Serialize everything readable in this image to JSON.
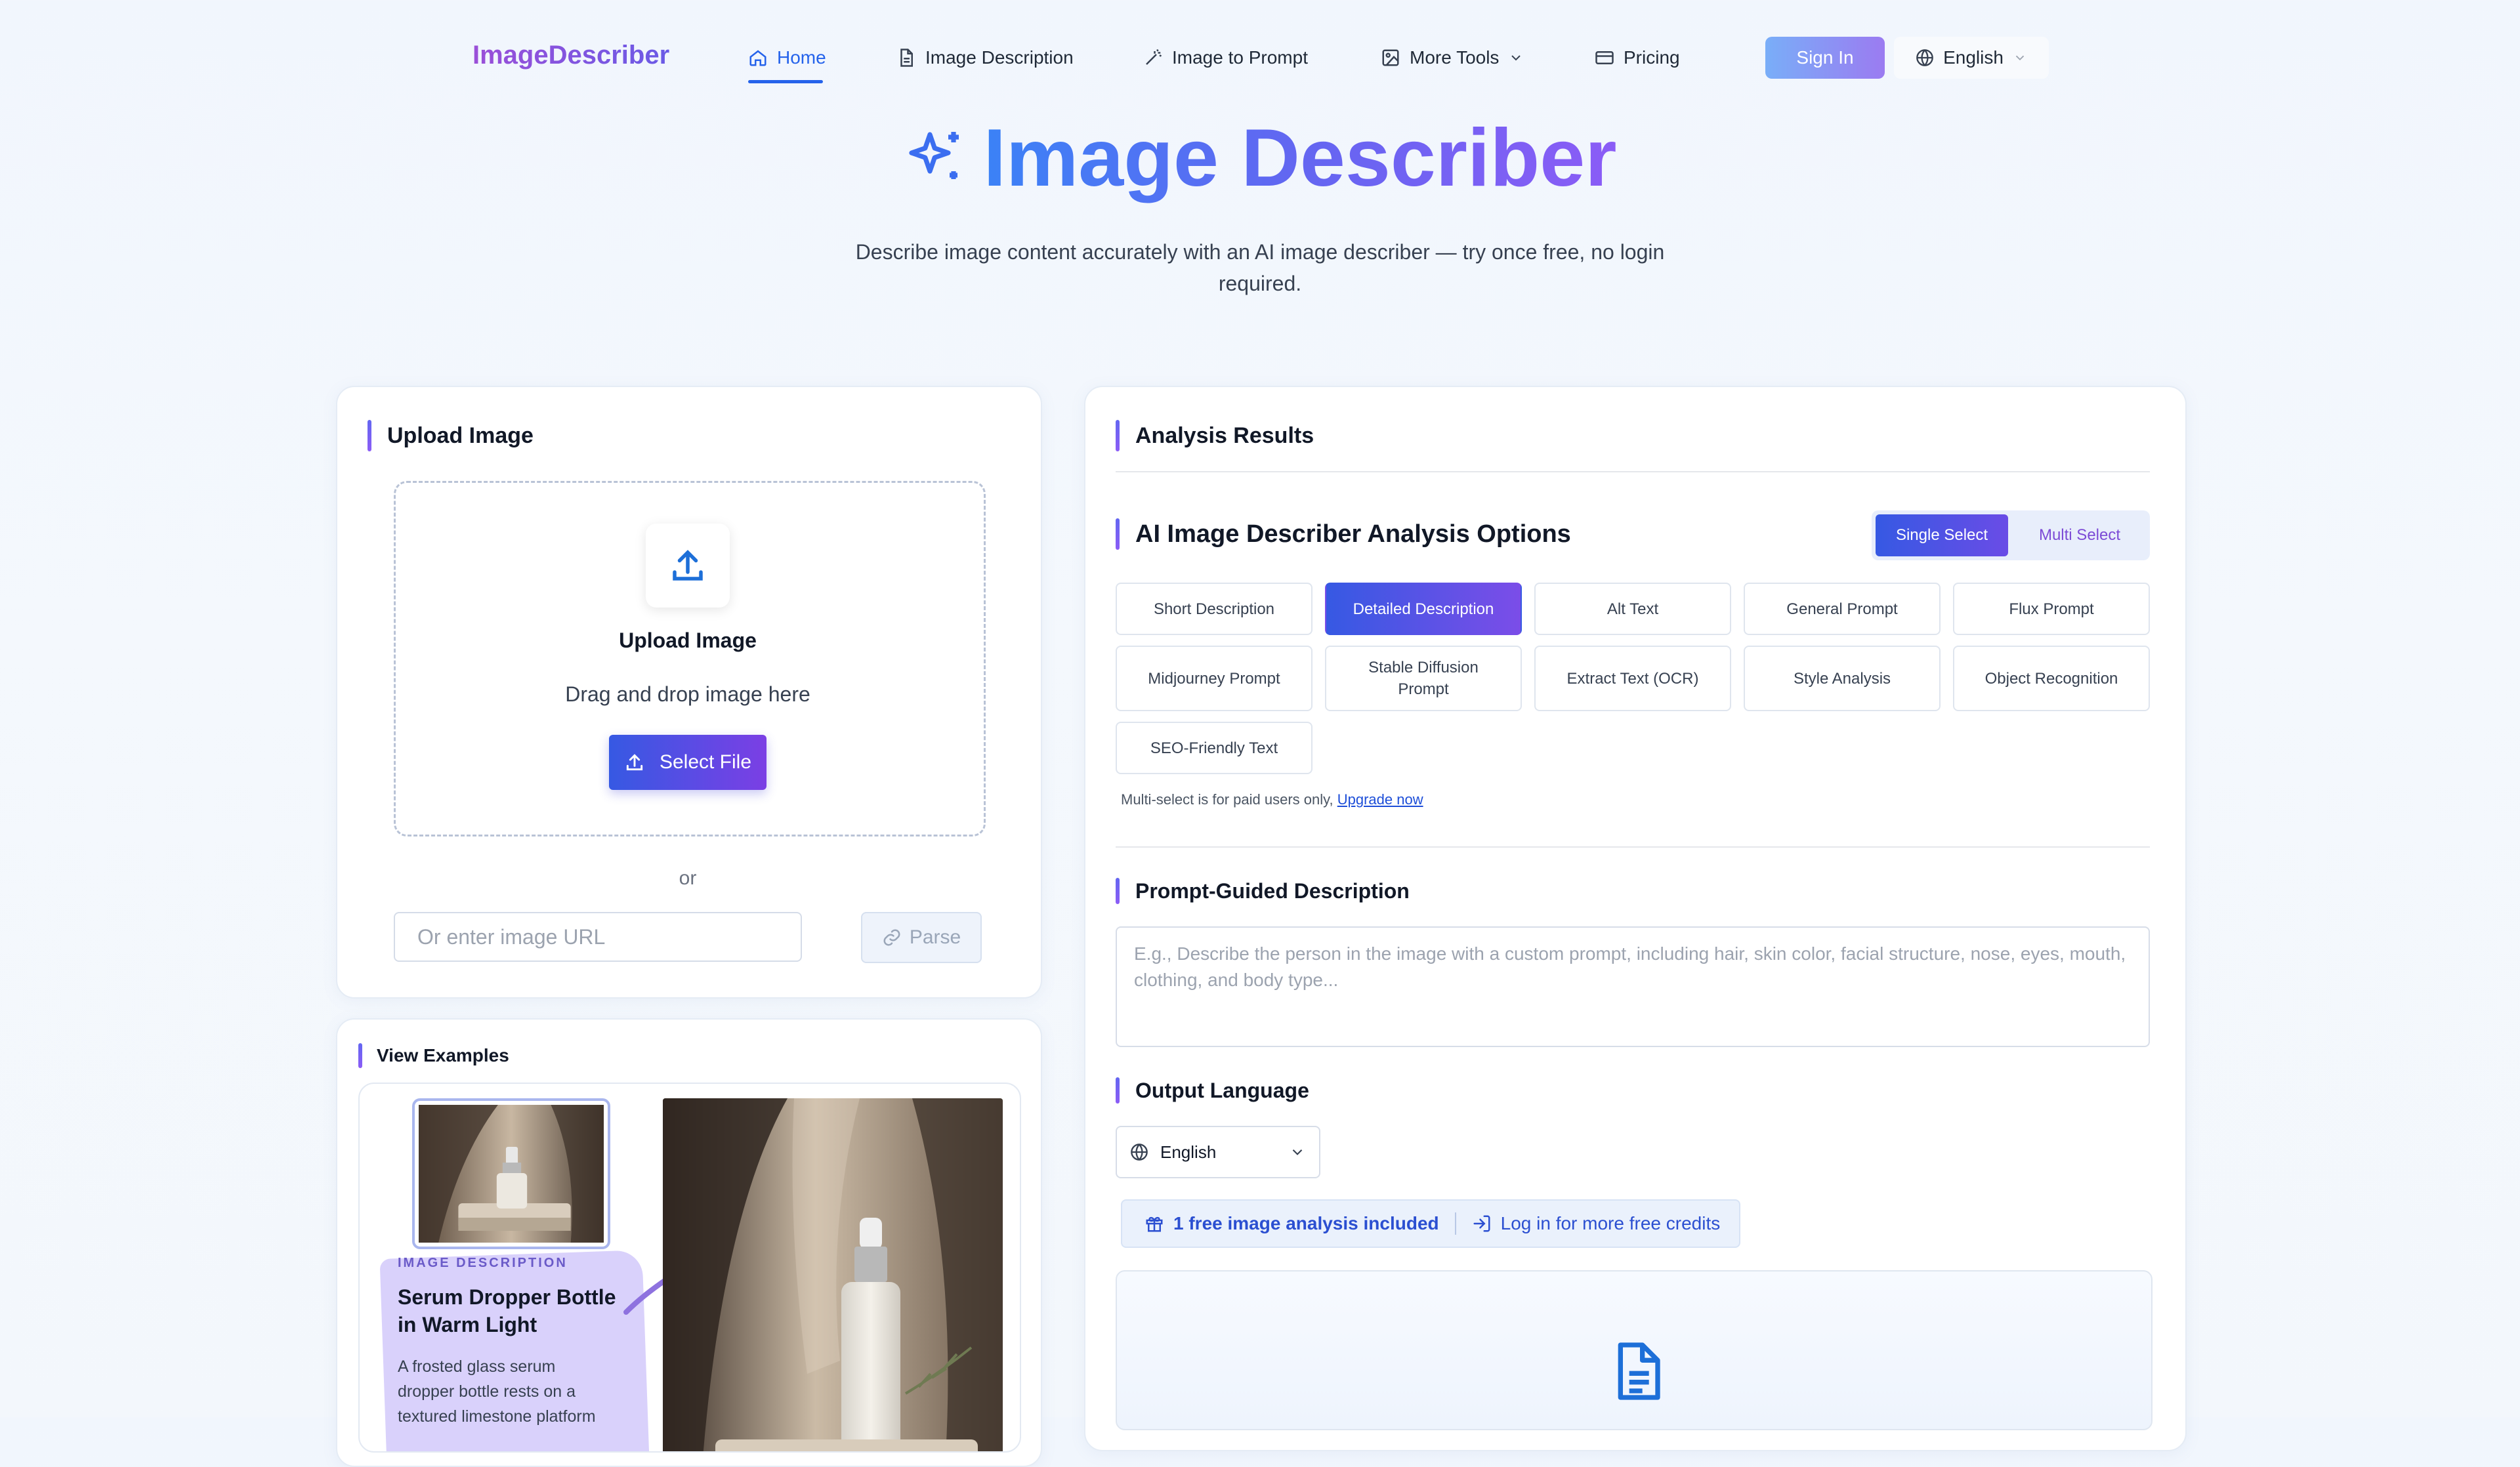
{
  "nav": {
    "logo": "ImageDescriber",
    "items": [
      {
        "label": "Home"
      },
      {
        "label": "Image Description"
      },
      {
        "label": "Image to Prompt"
      },
      {
        "label": "More Tools"
      },
      {
        "label": "Pricing"
      }
    ],
    "sign_in": "Sign In",
    "language": "English"
  },
  "hero": {
    "title": "Image Describer",
    "subtitle": "Describe image content accurately with an AI image describer — try once free, no login required."
  },
  "upload": {
    "title": "Upload Image",
    "drop_title": "Upload Image",
    "drop_hint": "Drag and drop image here",
    "select_file": "Select File",
    "or": "or",
    "url_placeholder": "Or enter image URL",
    "parse": "Parse"
  },
  "examples": {
    "title": "View Examples",
    "tag": "IMAGE DESCRIPTION",
    "heading_line1": "Serum Dropper Bottle",
    "heading_line2": "in Warm Light",
    "text_line1": "A frosted glass serum",
    "text_line2": "dropper bottle rests on a",
    "text_line3": "textured limestone platform"
  },
  "results": {
    "title": "Analysis Results",
    "options_title": "AI Image Describer Analysis Options",
    "single_select": "Single Select",
    "multi_select": "Multi Select",
    "options": [
      "Short Description",
      "Detailed Description",
      "Alt Text",
      "General Prompt",
      "Flux Prompt",
      "Midjourney Prompt",
      "Stable Diffusion Prompt",
      "Extract Text (OCR)",
      "Style Analysis",
      "Object Recognition",
      "SEO-Friendly Text"
    ],
    "active_option": "Detailed Description",
    "multi_note": "Multi-select is for paid users only,",
    "upgrade": "Upgrade now",
    "prompt_title": "Prompt-Guided Description",
    "prompt_placeholder": "E.g., Describe the person in the image with a custom prompt, including hair, skin color, facial structure, nose, eyes, mouth, clothing, and body type...",
    "output_lang_title": "Output Language",
    "output_lang": "English",
    "free_credit": "1 free image analysis included",
    "login_credits": "Log in for more free credits"
  },
  "colors": {
    "accent": "#2563eb",
    "purple": "#7b3fe4",
    "page_bg": "#f2f7fd"
  }
}
